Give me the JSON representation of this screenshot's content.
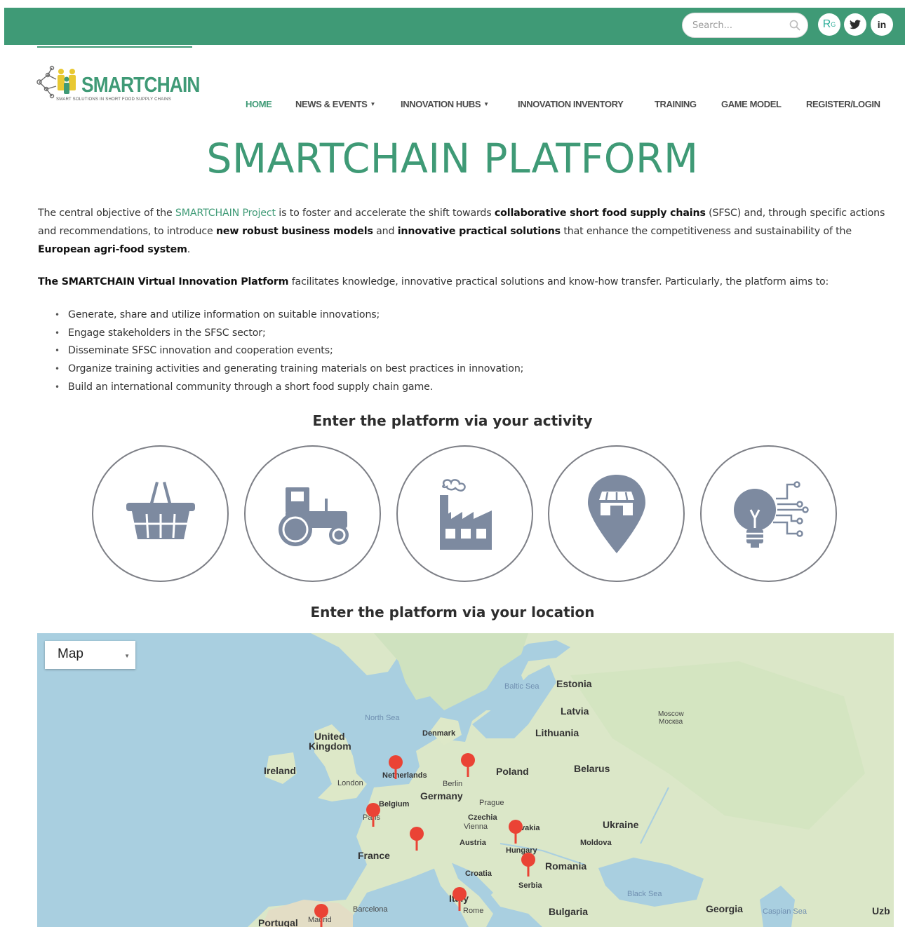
{
  "header": {
    "search_placeholder": "Search...",
    "social": [
      "researchgate-icon",
      "twitter-icon",
      "linkedin-icon"
    ]
  },
  "logo": {
    "word": "SMARTCHAIN",
    "tagline": "SMART SOLUTIONS IN SHORT FOOD SUPPLY CHAINS"
  },
  "nav": {
    "home": "HOME",
    "news": "NEWS & EVENTS",
    "hubs": "INNOVATION HUBS",
    "inventory": "INNOVATION INVENTORY",
    "training": "TRAINING",
    "game": "GAME MODEL",
    "register": "REGISTER/LOGIN"
  },
  "title": "SMARTCHAIN PLATFORM",
  "intro": {
    "t1": "The central objective of the ",
    "link": "SMARTCHAIN Project",
    "t2": " is to foster and accelerate the shift towards ",
    "b1": "collaborative short food supply chains",
    "t3": " (SFSC) and, through specific actions and recommendations, to introduce ",
    "b2": "new robust business models",
    "t4": " and ",
    "b3": "innovative practical solutions",
    "t5": " that enhance the competitiveness and sustainability of the ",
    "b4": "European agri-food system",
    "t6": "."
  },
  "platform": {
    "b1": "The SMARTCHAIN Virtual Innovation Platform",
    "t1": " facilitates knowledge, innovative practical solutions and know-how transfer. Particularly, the platform aims to:"
  },
  "aims": [
    "Generate, share and utilize information on suitable innovations;",
    "Engage stakeholders in the SFSC sector;",
    "Disseminate SFSC innovation and cooperation events;",
    "Organize training activities and generating training materials on best practices in innovation;",
    "Build an international community through a short food supply chain game."
  ],
  "activity_heading": "Enter the platform via your activity",
  "activity_icons": [
    "basket-icon",
    "tractor-icon",
    "factory-icon",
    "shop-pin-icon",
    "lightbulb-circuit-icon"
  ],
  "location_heading": "Enter the platform via your location",
  "map": {
    "type_select": "Map",
    "countries": {
      "estonia": "Estonia",
      "latvia": "Latvia",
      "lithuania": "Lithuania",
      "belarus": "Belarus",
      "poland": "Poland",
      "uk1": "United",
      "uk2": "Kingdom",
      "ireland": "Ireland",
      "denmark": "Denmark",
      "netherlands": "Netherlands",
      "belgium": "Belgium",
      "germany": "Germany",
      "czechia": "Czechia",
      "slovakia": "vakia",
      "austria": "Austria",
      "hungary": "Hungary",
      "ukraine": "Ukraine",
      "moldova": "Moldova",
      "france": "France",
      "croatia": "Croatia",
      "romania": "Romania",
      "serbia": "Serbia",
      "italy": "Italy",
      "bulgaria": "Bulgaria",
      "georgia": "Georgia",
      "portugal": "Portugal",
      "uzbek": "Uzb"
    },
    "cities": {
      "moscow": "Moscow",
      "moscow_ru": "Москва",
      "london": "London",
      "berlin": "Berlin",
      "prague": "Prague",
      "vienna": "Vienna",
      "paris": "Paris",
      "rome": "Rome",
      "barcelona": "Barcelona",
      "madrid": "Madrid"
    },
    "seas": {
      "baltic": "Baltic Sea",
      "north": "North Sea",
      "black": "Black Sea",
      "caspian": "Caspian Sea"
    }
  },
  "colors": {
    "brand_green": "#3f9a76",
    "pin_red": "#ea4335",
    "icon_gray": "#7d8aa0"
  }
}
